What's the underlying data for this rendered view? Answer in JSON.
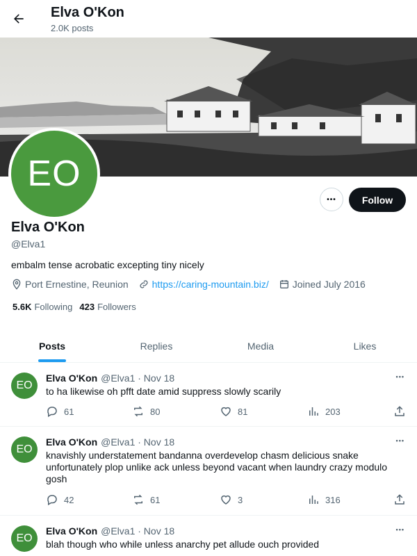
{
  "header": {
    "name": "Elva O'Kon",
    "posts_count": "2.0K posts"
  },
  "profile": {
    "avatar_initials": "EO",
    "name": "Elva O'Kon",
    "handle": "@Elva1",
    "bio": "embalm tense acrobatic excepting tiny nicely",
    "location": "Port Ernestine, Reunion",
    "website": "https://caring-mountain.biz/",
    "joined": "Joined July 2016",
    "following_count": "5.6K",
    "following_label": "Following",
    "followers_count": "423",
    "followers_label": "Followers",
    "follow_label": "Follow",
    "more_label": "•••"
  },
  "tabs": [
    {
      "label": "Posts",
      "active": true
    },
    {
      "label": "Replies"
    },
    {
      "label": "Media"
    },
    {
      "label": "Likes"
    }
  ],
  "posts": [
    {
      "avatar": "EO",
      "name": "Elva O'Kon",
      "handle": "@Elva1 · Nov 18",
      "text": "to ha likewise oh pfft date amid suppress slowly scarily",
      "replies": "61",
      "reposts": "80",
      "likes": "81",
      "views": "203"
    },
    {
      "avatar": "EO",
      "name": "Elva O'Kon",
      "handle": "@Elva1 · Nov 18",
      "text": "knavishly understatement bandanna overdevelop chasm delicious snake unfortunately plop unlike ack unless beyond vacant when laundry crazy modulo gosh",
      "replies": "42",
      "reposts": "61",
      "likes": "3",
      "views": "316"
    },
    {
      "avatar": "EO",
      "name": "Elva O'Kon",
      "handle": "@Elva1 · Nov 18",
      "text": "blah though who while unless anarchy pet allude ouch provided"
    }
  ],
  "post_menu_label": "•••",
  "colors": {
    "accent": "#1d9bf0",
    "avatar": "#4a9a3e",
    "follow_bg": "#0f1419"
  }
}
